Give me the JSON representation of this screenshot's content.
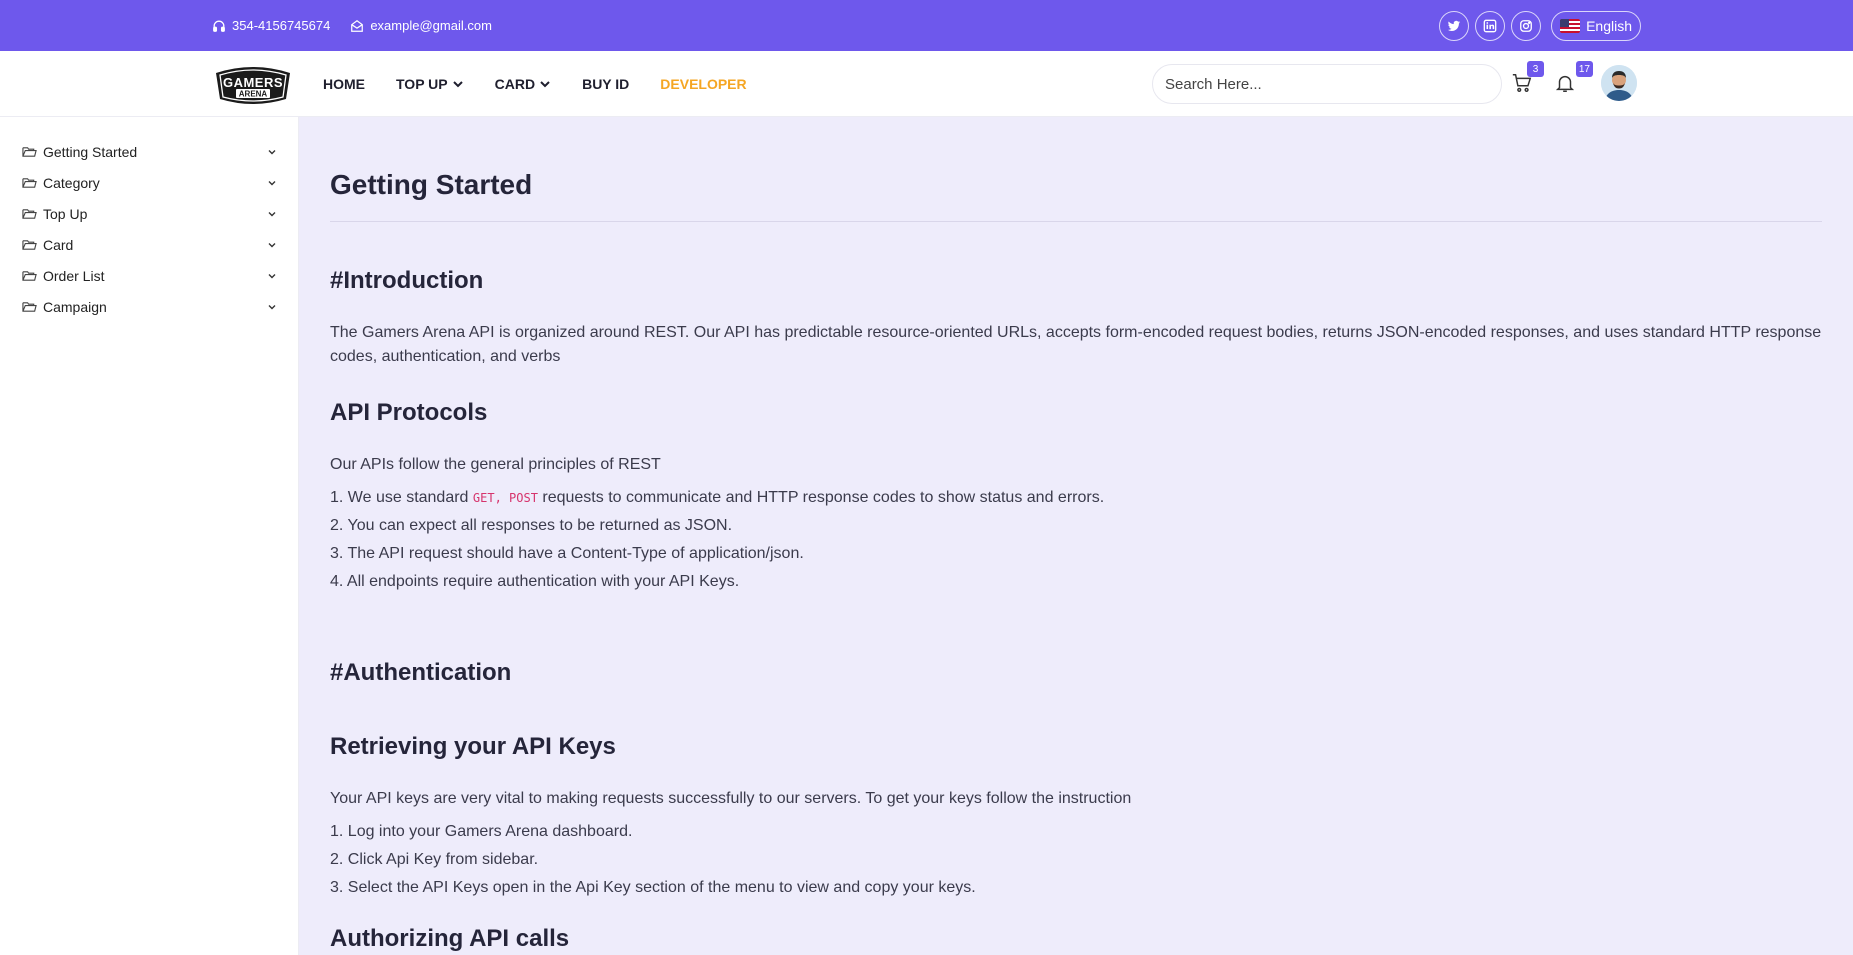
{
  "topbar": {
    "phone": "354-4156745674",
    "email": "example@gmail.com",
    "language": "English",
    "socials": [
      "twitter-icon",
      "linkedin-icon",
      "instagram-icon"
    ]
  },
  "nav": {
    "menu": [
      {
        "label": "HOME",
        "dropdown": false
      },
      {
        "label": "TOP UP",
        "dropdown": true
      },
      {
        "label": "CARD",
        "dropdown": true
      },
      {
        "label": "BUY ID",
        "dropdown": false
      },
      {
        "label": "DEVELOPER",
        "dropdown": false,
        "active": true
      }
    ],
    "search_placeholder": "Search Here...",
    "cart_count": "3",
    "notification_count": "17",
    "logo_text": "GAMERS ARENA"
  },
  "sidebar": {
    "items": [
      {
        "label": "Getting Started"
      },
      {
        "label": "Category"
      },
      {
        "label": "Top Up"
      },
      {
        "label": "Card"
      },
      {
        "label": "Order List"
      },
      {
        "label": "Campaign"
      }
    ]
  },
  "content": {
    "title": "Getting Started",
    "introduction": {
      "heading": "#Introduction",
      "text": "The Gamers Arena API is organized around REST. Our API has predictable resource-oriented URLs, accepts form-encoded request bodies, returns JSON-encoded responses, and uses standard HTTP response codes, authentication, and verbs"
    },
    "protocols": {
      "heading": "API Protocols",
      "intro": "Our APIs follow the general principles of REST",
      "item1_prefix": "1. We use standard ",
      "item1_code": "GET, POST",
      "item1_suffix": " requests to communicate and HTTP response codes to show status and errors.",
      "item2": "2. You can expect all responses to be returned as JSON.",
      "item3": "3. The API request should have a Content-Type of application/json.",
      "item4": "4. All endpoints require authentication with your API Keys."
    },
    "authentication": {
      "heading": "#Authentication",
      "subheading": "Retrieving your API Keys",
      "text": "Your API keys are very vital to making requests successfully to our servers. To get your keys follow the instruction",
      "steps": [
        "1. Log into your Gamers Arena dashboard.",
        "2. Click Api Key from sidebar.",
        "3. Select the API Keys open in the Api Key section of the menu to view and copy your keys."
      ],
      "next_heading": "Authorizing API calls"
    }
  },
  "colors": {
    "brand": "#6e58ec",
    "active_menu": "#f5a623",
    "main_bg": "#eeecfb",
    "code": "#d6336c"
  }
}
